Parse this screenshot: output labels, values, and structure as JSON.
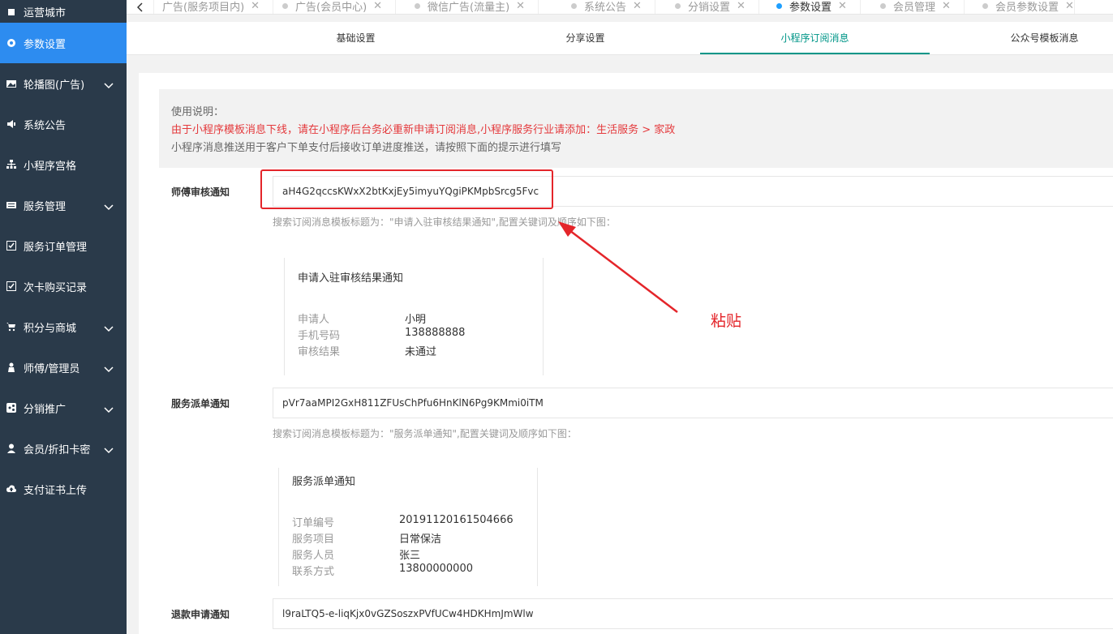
{
  "sidebar": {
    "items": [
      {
        "label": "运营城市",
        "icon": "city-icon",
        "chevron": false,
        "active": false
      },
      {
        "label": "参数设置",
        "icon": "gear-icon",
        "chevron": false,
        "active": true
      },
      {
        "label": "轮播图(广告)",
        "icon": "image-icon",
        "chevron": true,
        "active": false
      },
      {
        "label": "系统公告",
        "icon": "speaker-icon",
        "chevron": false,
        "active": false
      },
      {
        "label": "小程序宫格",
        "icon": "sitemap-icon",
        "chevron": false,
        "active": false
      },
      {
        "label": "服务管理",
        "icon": "list-icon",
        "chevron": true,
        "active": false
      },
      {
        "label": "服务订单管理",
        "icon": "checkbox-icon",
        "chevron": false,
        "active": false
      },
      {
        "label": "次卡购买记录",
        "icon": "checkbox-icon",
        "chevron": false,
        "active": false
      },
      {
        "label": "积分与商城",
        "icon": "cart-icon",
        "chevron": true,
        "active": false
      },
      {
        "label": "师傅/管理员",
        "icon": "user-icon",
        "chevron": true,
        "active": false
      },
      {
        "label": "分销推广",
        "icon": "share-icon",
        "chevron": true,
        "active": false
      },
      {
        "label": "会员/折扣卡密",
        "icon": "member-icon",
        "chevron": true,
        "active": false
      },
      {
        "label": "支付证书上传",
        "icon": "cloud-upload-icon",
        "chevron": false,
        "active": false
      }
    ]
  },
  "tabs": [
    {
      "label": "广告(服务项目内)",
      "active": false
    },
    {
      "label": "广告(会员中心)",
      "active": false
    },
    {
      "label": "微信广告(流量主)",
      "active": false
    },
    {
      "label": "系统公告",
      "active": false
    },
    {
      "label": "分销设置",
      "active": false
    },
    {
      "label": "参数设置",
      "active": true
    },
    {
      "label": "会员管理",
      "active": false
    },
    {
      "label": "会员参数设置",
      "active": false
    }
  ],
  "subtabs": [
    {
      "label": "基础设置",
      "active": false
    },
    {
      "label": "分享设置",
      "active": false
    },
    {
      "label": "小程序订阅消息",
      "active": true
    },
    {
      "label": "公众号模板消息",
      "active": false
    }
  ],
  "notice": {
    "line1": "使用说明：",
    "line2": "由于小程序模板消息下线，请在小程序后台务必重新申请订阅消息,小程序服务行业请添加：生活服务 > 家政",
    "line3": "小程序消息推送用于客户下单支付后接收订单进度推送，请按照下面的提示进行填写"
  },
  "fields": [
    {
      "label": "师傅审核通知",
      "value": "aH4G2qccsKWxX2btKxjEy5imyuYQgiPKMpbSrcg5Fvc",
      "hint": "搜索订阅消息模板标题为：\"申请入驻审核结果通知\",配置关键词及顺序如下图：",
      "preview": {
        "title": "申请入驻审核结果通知",
        "rows": [
          {
            "k": "申请人",
            "v": "小明"
          },
          {
            "k": "手机号码",
            "v": "138888888"
          },
          {
            "k": "审核结果",
            "v": "未通过"
          }
        ]
      }
    },
    {
      "label": "服务派单通知",
      "value": "pVr7aaMPI2GxH811ZFUsChPfu6HnKlN6Pg9KMmi0iTM",
      "hint": "搜索订阅消息模板标题为：\"服务派单通知\",配置关键词及顺序如下图：",
      "preview": {
        "title": "服务派单通知",
        "rows": [
          {
            "k": "订单编号",
            "v": "20191120161504666"
          },
          {
            "k": "服务项目",
            "v": "日常保洁"
          },
          {
            "k": "服务人员",
            "v": "张三"
          },
          {
            "k": "联系方式",
            "v": "13800000000"
          }
        ]
      }
    },
    {
      "label": "退款申请通知",
      "value": "l9raLTQ5-e-liqKjx0vGZSoszxPVfUCw4HDKHmJmWlw"
    }
  ],
  "annotation": {
    "text": "粘贴",
    "color": "#e4252a"
  },
  "colors": {
    "sidebar_bg": "#2a3a4a",
    "active_blue": "#2d8cf0",
    "subtab_active": "#009688",
    "notice_red": "#e4393c"
  }
}
